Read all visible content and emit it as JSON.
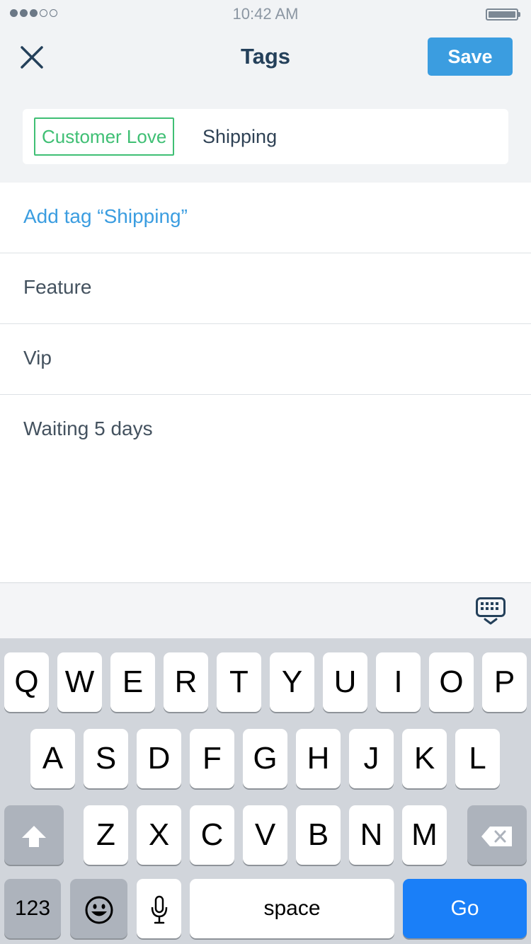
{
  "status_bar": {
    "time": "10:42 AM",
    "signal_bars": 3,
    "signal_total": 5,
    "battery_level": 1.0
  },
  "nav": {
    "title": "Tags",
    "save_label": "Save",
    "close_icon": "close-icon"
  },
  "tag_field": {
    "chips": [
      "Customer Love"
    ],
    "input_value": "Shipping"
  },
  "list": {
    "add_label": "Add tag “Shipping”",
    "items": [
      "Feature",
      "Vip",
      "Waiting 5 days"
    ]
  },
  "accessory": {
    "dismiss_icon": "keyboard-dismiss-icon"
  },
  "keyboard": {
    "row1": [
      "Q",
      "W",
      "E",
      "R",
      "T",
      "Y",
      "U",
      "I",
      "O",
      "P"
    ],
    "row2": [
      "A",
      "S",
      "D",
      "F",
      "G",
      "H",
      "J",
      "K",
      "L"
    ],
    "row3": [
      "Z",
      "X",
      "C",
      "V",
      "B",
      "N",
      "M"
    ],
    "numbers_label": "123",
    "space_label": "space",
    "go_label": "Go",
    "icons": {
      "shift": "shift-icon",
      "delete": "backspace-icon",
      "emoji": "emoji-icon",
      "mic": "microphone-icon"
    }
  },
  "colors": {
    "accent": "#3b9de0",
    "tag_green": "#3fbf74",
    "go_blue": "#1a7ff8"
  }
}
